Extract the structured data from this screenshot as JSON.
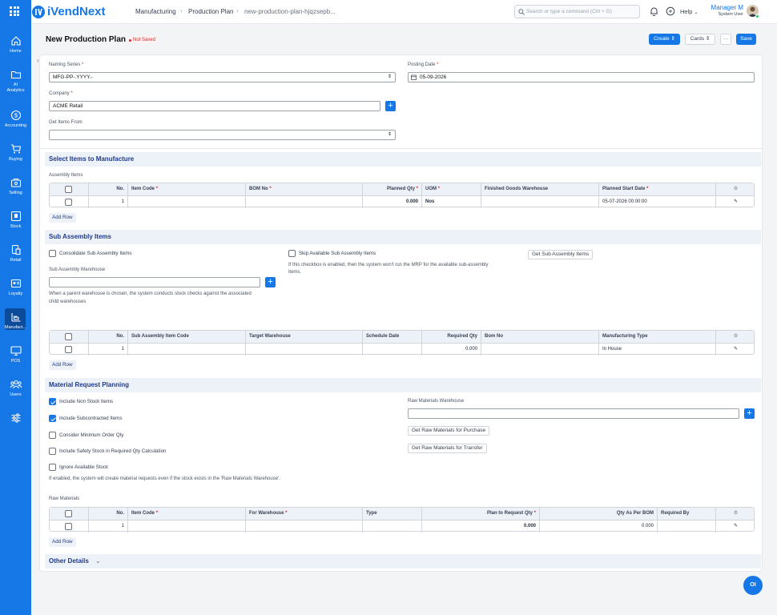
{
  "app": {
    "name": "iVendNext"
  },
  "sidebar": {
    "items": [
      {
        "label": "Home",
        "icon": "home-icon"
      },
      {
        "label": "AI Analytics",
        "icon": "folder-icon"
      },
      {
        "label": "Accounting",
        "icon": "dollar-icon"
      },
      {
        "label": "Buying",
        "icon": "cart-icon"
      },
      {
        "label": "Selling",
        "icon": "selling-icon"
      },
      {
        "label": "Stock",
        "icon": "stock-icon"
      },
      {
        "label": "Retail",
        "icon": "retail-icon"
      },
      {
        "label": "Loyalty",
        "icon": "loyalty-icon"
      },
      {
        "label": "Manufact...",
        "icon": "manufacturing-icon"
      },
      {
        "label": "POS",
        "icon": "monitor-icon"
      },
      {
        "label": "Users",
        "icon": "users-icon"
      },
      {
        "label": "",
        "icon": "settings-sliders-icon"
      }
    ]
  },
  "header": {
    "breadcrumbs": [
      "Manufacturing",
      "Production Plan",
      "new-production-plan-hjqzsepb..."
    ],
    "search_placeholder": "Search or type a command (Ctrl + G)",
    "help_label": "Help",
    "user_name": "Manager M",
    "user_role": "System User"
  },
  "page": {
    "title": "New Production Plan",
    "status": "Not Saved",
    "create_label": "Create",
    "cards_label": "Cards",
    "more_label": "···",
    "save_label": "Save"
  },
  "form": {
    "naming_series_label": "Naming Series",
    "naming_series_value": "MFG-PP-.YYYY.-",
    "posting_date_label": "Posting Date",
    "posting_date_value": "05-09-2026",
    "company_label": "Company",
    "company_value": "ACME Retail",
    "get_items_from_label": "Get Items From",
    "get_items_from_value": ""
  },
  "select_items": {
    "title": "Select Items to Manufacture",
    "table_label": "Assembly Items",
    "columns": [
      "No.",
      "Item Code",
      "BOM No",
      "Planned Qty",
      "UOM",
      "Finished Goods Warehouse",
      "Planned Start Date"
    ],
    "row": {
      "no": "1",
      "item_code": "",
      "bom_no": "",
      "planned_qty": "0.000",
      "uom": "Nos",
      "fg_warehouse": "",
      "planned_start": "05-07-2026 00:00:00"
    },
    "add_row_label": "Add Row"
  },
  "sub_assembly": {
    "title": "Sub Assembly Items",
    "consolidate_label": "Consolidate Sub Assembly Items",
    "skip_label": "Skip Available Sub Assembly Items",
    "skip_help_1": "If this checkbox is enabled, then the system won't run the MRP for the available sub-assembly",
    "skip_help_2": "items.",
    "get_button": "Get Sub Assembly Items",
    "warehouse_label": "Sub Assembly Warehouse",
    "warehouse_help_1": "When a parent warehouse is chosen, the system conducts stock checks against the associated",
    "warehouse_help_2": "child warehouses",
    "columns": [
      "No.",
      "Sub Assembly Item Code",
      "Target Warehouse",
      "Schedule Date",
      "Required Qty",
      "Bom No",
      "Manufacturing Type"
    ],
    "row": {
      "no": "1",
      "item_code": "",
      "target": "",
      "schedule": "",
      "required_qty": "0.000",
      "bom_no": "",
      "mfg_type": "In House"
    },
    "add_row_label": "Add Row"
  },
  "material_request": {
    "title": "Material Request Planning",
    "checks": [
      {
        "label": "Include Non Stock Items",
        "checked": true
      },
      {
        "label": "Include Subcontracted Items",
        "checked": true
      },
      {
        "label": "Consider Minimum Order Qty",
        "checked": false
      },
      {
        "label": "Include Safety Stock in Required Qty Calculation",
        "checked": false
      },
      {
        "label": "Ignore Available Stock",
        "checked": false
      }
    ],
    "ignore_help": "If enabled, the system will create material requests even if the stock exists in the 'Raw Materials Warehouse'.",
    "raw_warehouse_label": "Raw Materials Warehouse",
    "purchase_button": "Get Raw Materials for Purchase",
    "transfer_button": "Get Raw Materials for Transfer",
    "table_label": "Raw Materials",
    "columns": [
      "No.",
      "Item Code",
      "For Warehouse",
      "Type",
      "Plan to Request Qty",
      "Qty As Per BOM",
      "Required By"
    ],
    "row": {
      "no": "1",
      "item_code": "",
      "for_warehouse": "",
      "type": "",
      "plan_qty": "0.000",
      "bom_qty": "0.000",
      "required_by": ""
    },
    "add_row_label": "Add Row"
  },
  "other_details": {
    "title": "Other Details"
  },
  "fab": {
    "label": "OI"
  }
}
